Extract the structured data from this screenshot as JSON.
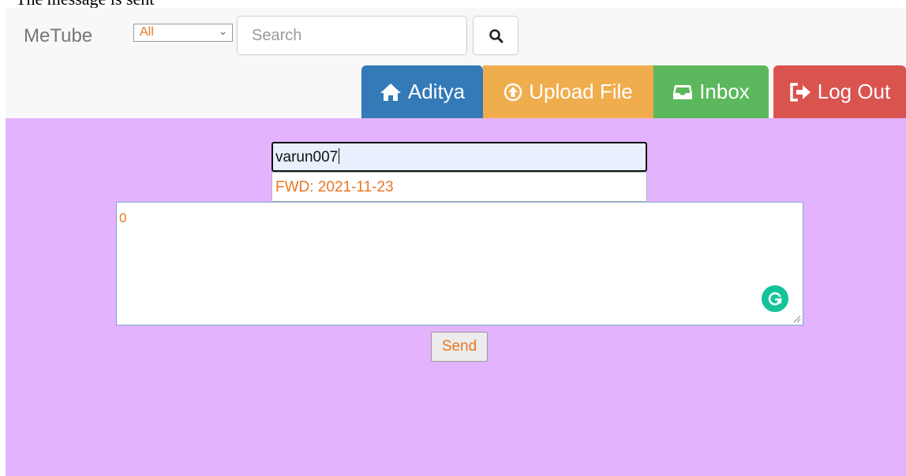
{
  "caption": "The message is sent",
  "brand": "MeTube",
  "search": {
    "category": "All",
    "placeholder": "Search",
    "search_icon": "magnifier-icon"
  },
  "nav": {
    "home_label": "Aditya",
    "upload_label": "Upload File",
    "inbox_label": "Inbox",
    "logout_label": "Log Out"
  },
  "compose": {
    "to_value": "varun007",
    "subject_value": "FWD: 2021-11-23",
    "message_value": "0",
    "send_label": "Send"
  },
  "colors": {
    "page_background": "#e4b3fd",
    "navbar_background": "#f8f8f8",
    "home_button": "#337ab7",
    "upload_button": "#f0ad4e",
    "inbox_button": "#5cb85c",
    "logout_button": "#d9534f",
    "text_accent": "#e87722",
    "grammarly": "#15c39a"
  }
}
